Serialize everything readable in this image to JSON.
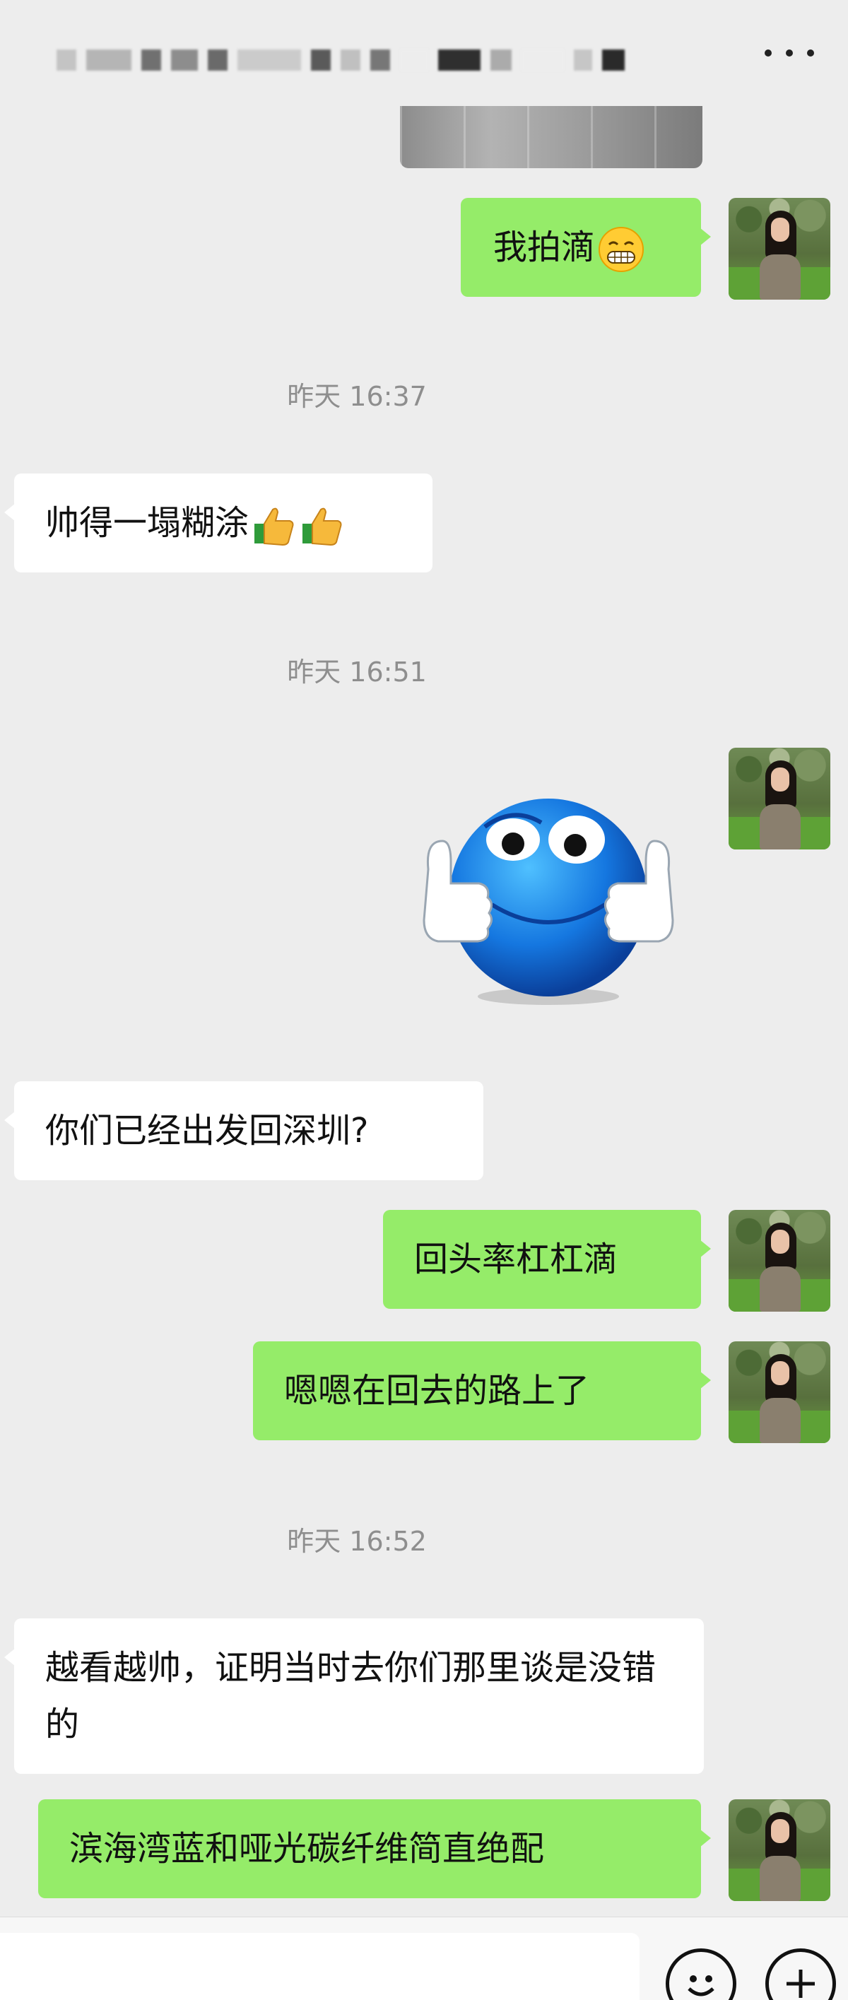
{
  "header": {
    "title": "",
    "more_icon": "more-icon"
  },
  "messages": {
    "m1": {
      "text": "我拍滴"
    },
    "t1": "昨天 16:37",
    "m2": {
      "text": "帅得一塌糊涂"
    },
    "t2": "昨天 16:51",
    "m3": {
      "sticker": "thumbs-up-blue-smiley-sticker"
    },
    "m4": {
      "text": "你们已经出发回深圳?"
    },
    "m5": {
      "text": "回头率杠杠滴"
    },
    "m6": {
      "text": "嗯嗯在回去的路上了"
    },
    "t3": "昨天 16:52",
    "m7": {
      "text": "越看越帅，证明当时去你们那里谈是没错的"
    },
    "m8": {
      "text": "滨海湾蓝和哑光碳纤维简直绝配"
    }
  },
  "input_bar": {
    "emoji_icon": "smiley-icon",
    "plus_icon": "plus-icon"
  },
  "colors": {
    "background": "#ededed",
    "outgoing_bubble": "#95ec69",
    "incoming_bubble": "#ffffff",
    "timestamp": "#8e8e8e"
  }
}
